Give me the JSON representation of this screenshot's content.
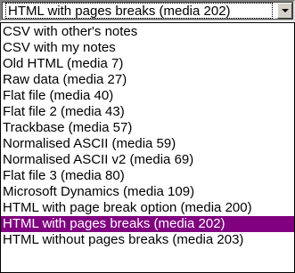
{
  "dropdown": {
    "selected_value": "HTML with pages breaks (media 202)",
    "icon": "chevron-down-icon",
    "selection_color": "#800080",
    "items": [
      {
        "label": "CSV with other's notes",
        "selected": false
      },
      {
        "label": "CSV with my notes",
        "selected": false
      },
      {
        "label": "Old HTML (media 7)",
        "selected": false
      },
      {
        "label": "Raw data (media 27)",
        "selected": false
      },
      {
        "label": "Flat file (media 40)",
        "selected": false
      },
      {
        "label": "Flat file 2 (media 43)",
        "selected": false
      },
      {
        "label": "Trackbase (media 57)",
        "selected": false
      },
      {
        "label": "Normalised ASCII (media 59)",
        "selected": false
      },
      {
        "label": "Normalised ASCII v2 (media 69)",
        "selected": false
      },
      {
        "label": "Flat file 3 (media 80)",
        "selected": false
      },
      {
        "label": "Microsoft Dynamics (media 109)",
        "selected": false
      },
      {
        "label": "HTML with page break option (media 200)",
        "selected": false
      },
      {
        "label": "HTML with pages breaks (media 202)",
        "selected": true
      },
      {
        "label": "HTML without pages breaks (media 203)",
        "selected": false
      }
    ]
  }
}
